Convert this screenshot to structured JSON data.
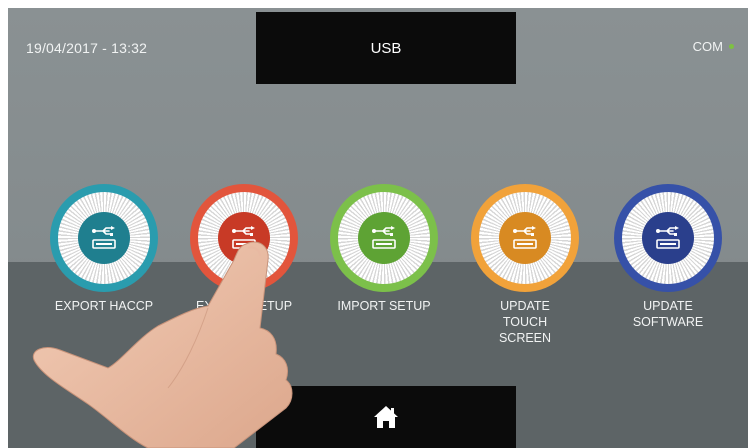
{
  "header": {
    "datetime": "19/04/2017 - 13:32",
    "title": "USB",
    "status_label": "COM",
    "status_color": "#7ec142"
  },
  "tiles": [
    {
      "label": "EXPORT HACCP",
      "ring_color": "#2a9cae",
      "core_color": "#1f7f8f",
      "icon": "usb-icon"
    },
    {
      "label": "EXPORT SETUP",
      "ring_color": "#e2553c",
      "core_color": "#c83a26",
      "icon": "usb-icon"
    },
    {
      "label": "IMPORT SETUP",
      "ring_color": "#7cc04a",
      "core_color": "#5ea334",
      "icon": "usb-icon"
    },
    {
      "label": "UPDATE TOUCH SCREEN",
      "ring_color": "#f1a23a",
      "core_color": "#d88a22",
      "icon": "usb-icon"
    },
    {
      "label": "UPDATE SOFTWARE",
      "ring_color": "#3651a8",
      "core_color": "#2a3f8c",
      "icon": "usb-icon"
    }
  ],
  "footer": {
    "home_icon": "home-icon"
  }
}
